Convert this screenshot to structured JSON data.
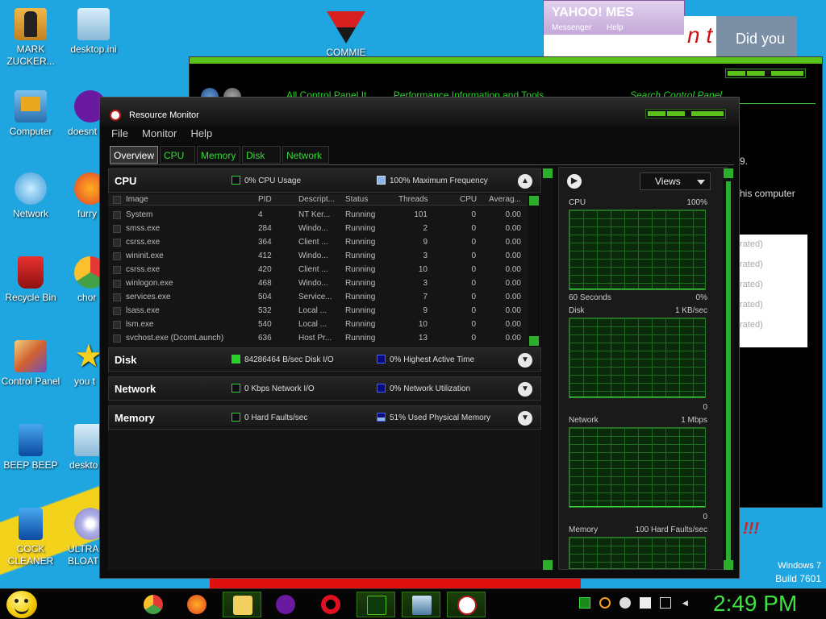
{
  "desktop": {
    "icons_left": [
      {
        "label": "MARK ZUCKER...",
        "icon": "person-icon"
      },
      {
        "label": "Computer",
        "icon": "computer-icon"
      },
      {
        "label": "Network",
        "icon": "network-icon"
      },
      {
        "label": "Recycle Bin",
        "icon": "recycle-bin-icon"
      },
      {
        "label": "Control Panel",
        "icon": "control-panel-icon"
      },
      {
        "label": "BEEP BEEP",
        "icon": "file-icon"
      },
      {
        "label": "COCK CLEANER",
        "icon": "file-icon"
      }
    ],
    "icons_col2": [
      {
        "label": "desktop.ini",
        "icon": "settings-file-icon"
      },
      {
        "label": "doesnt",
        "icon": "yahoo-icon"
      },
      {
        "label": "furry",
        "icon": "firefox-icon"
      },
      {
        "label": "chor",
        "icon": "chrome-icon"
      },
      {
        "label": "you t",
        "icon": "star-icon"
      },
      {
        "label": "deskto",
        "icon": "settings-file-icon"
      },
      {
        "label": "ULTRA BLOAT",
        "icon": "disc-icon"
      }
    ],
    "commie_label": "COMMIE",
    "windows_version": "Windows 7",
    "build": "Build 7601"
  },
  "yahoo": {
    "logo": "YAHOO! MES",
    "messenger": "Messenger",
    "help": "Help",
    "banner_text": "n t",
    "photo_text": "Did you"
  },
  "control_panel": {
    "address": [
      "All Control Panel It",
      "Performance Information and Tools"
    ],
    "search_placeholder": "Search Control Panel",
    "text1": "9.",
    "text2": "his computer",
    "rated": [
      "rated)",
      "rated)",
      "rated)",
      "rated)",
      "rated)"
    ],
    "exclaim": "!!!"
  },
  "resource_monitor": {
    "title": "Resource Monitor",
    "menu": [
      "File",
      "Monitor",
      "Help"
    ],
    "tabs": [
      "Overview",
      "CPU",
      "Memory",
      "Disk",
      "Network"
    ],
    "cpu": {
      "name": "CPU",
      "m1": "0% CPU Usage",
      "m2": "100% Maximum Frequency",
      "columns": [
        "Image",
        "PID",
        "Descript...",
        "Status",
        "Threads",
        "CPU",
        "Averag..."
      ],
      "rows": [
        [
          "System",
          "4",
          "NT Ker...",
          "Running",
          "101",
          "0",
          "0.00"
        ],
        [
          "smss.exe",
          "284",
          "Windo...",
          "Running",
          "2",
          "0",
          "0.00"
        ],
        [
          "csrss.exe",
          "364",
          "Client ...",
          "Running",
          "9",
          "0",
          "0.00"
        ],
        [
          "wininit.exe",
          "412",
          "Windo...",
          "Running",
          "3",
          "0",
          "0.00"
        ],
        [
          "csrss.exe",
          "420",
          "Client ...",
          "Running",
          "10",
          "0",
          "0.00"
        ],
        [
          "winlogon.exe",
          "468",
          "Windo...",
          "Running",
          "3",
          "0",
          "0.00"
        ],
        [
          "services.exe",
          "504",
          "Service...",
          "Running",
          "7",
          "0",
          "0.00"
        ],
        [
          "lsass.exe",
          "532",
          "Local ...",
          "Running",
          "9",
          "0",
          "0.00"
        ],
        [
          "lsm.exe",
          "540",
          "Local ...",
          "Running",
          "10",
          "0",
          "0.00"
        ],
        [
          "svchost.exe (DcomLaunch)",
          "636",
          "Host Pr...",
          "Running",
          "13",
          "0",
          "0.00"
        ]
      ]
    },
    "disk": {
      "name": "Disk",
      "m1": "84286464 B/sec Disk I/O",
      "m2": "0% Highest Active Time"
    },
    "network": {
      "name": "Network",
      "m1": "0 Kbps Network I/O",
      "m2": "0% Network Utilization"
    },
    "memory": {
      "name": "Memory",
      "m1": "0 Hard Faults/sec",
      "m2": "51% Used Physical Memory"
    },
    "views_label": "Views",
    "graphs": [
      {
        "name": "CPU",
        "max": "100%",
        "footer_left": "60 Seconds",
        "footer_right": "0%"
      },
      {
        "name": "Disk",
        "max": "1 KB/sec",
        "footer_right": "0"
      },
      {
        "name": "Network",
        "max": "1 Mbps",
        "footer_right": "0"
      },
      {
        "name": "Memory",
        "max": "100 Hard Faults/sec"
      }
    ]
  },
  "taskbar": {
    "apps": [
      "chrome-icon",
      "firefox-icon",
      "folder-icon",
      "yahoo-icon",
      "opera-icon",
      "performance-icon",
      "network-computer-icon",
      "resource-monitor-icon"
    ],
    "time": "2:49 PM"
  }
}
